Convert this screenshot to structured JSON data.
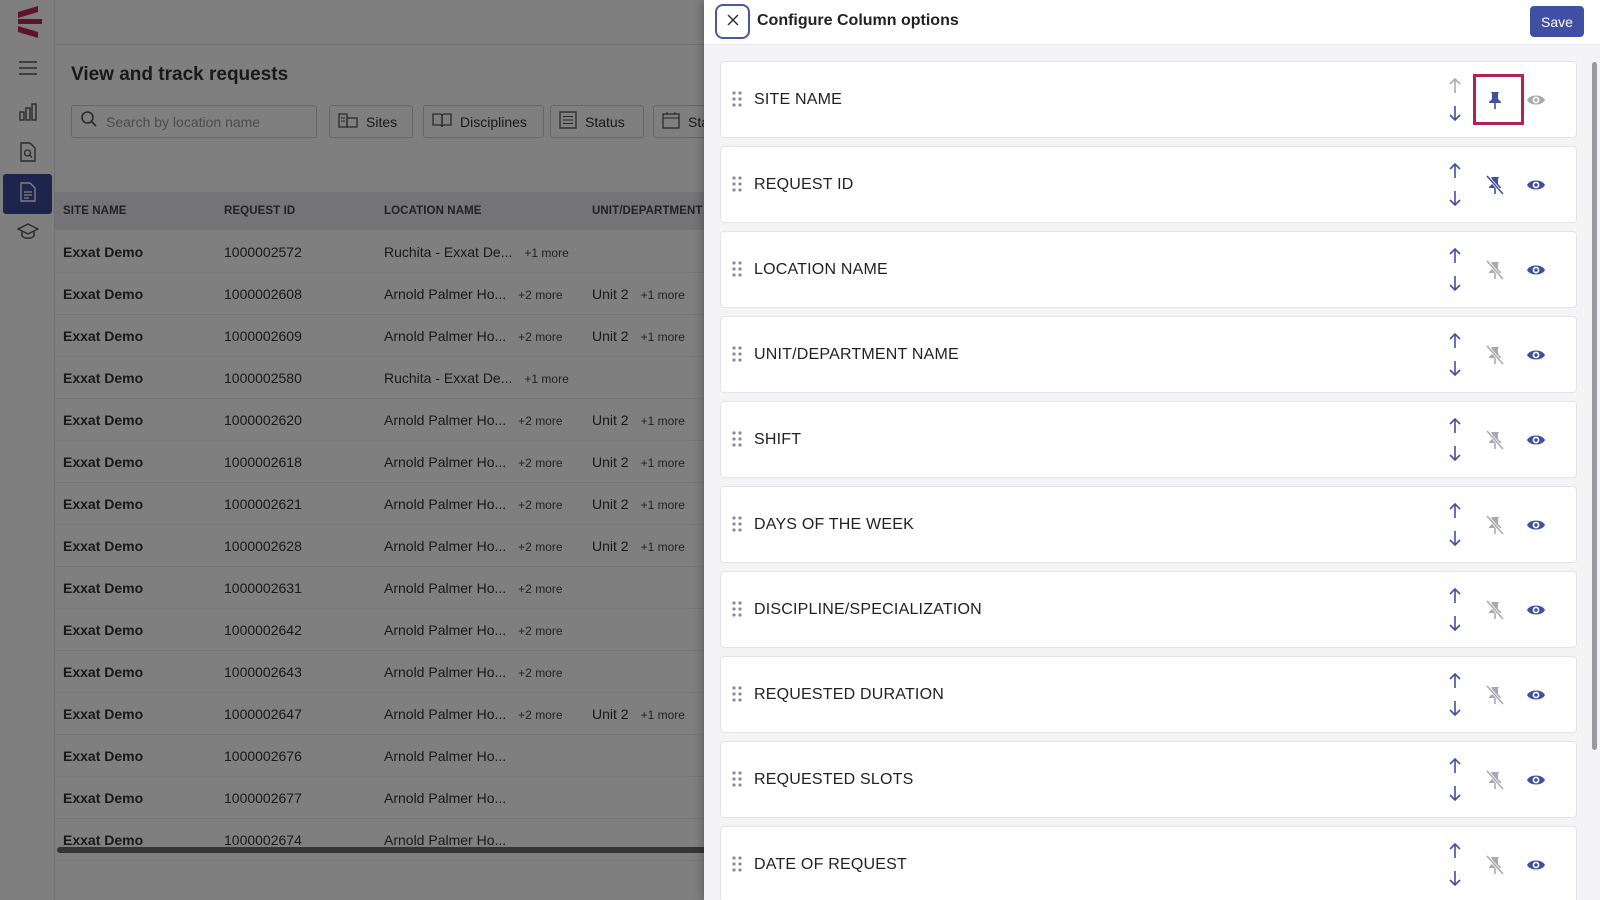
{
  "rail": {
    "items": [
      {
        "icon": "menu-icon",
        "active": false
      },
      {
        "icon": "bar-chart-icon",
        "active": false
      },
      {
        "icon": "document-search-icon",
        "active": false
      },
      {
        "icon": "document-icon",
        "active": true
      },
      {
        "icon": "graduation-cap-icon",
        "active": false
      }
    ]
  },
  "page": {
    "title": "View and track requests",
    "search_placeholder": "Search by location name",
    "filters": [
      {
        "label": "Sites",
        "icon": "sites-icon"
      },
      {
        "label": "Disciplines",
        "icon": "book-icon"
      },
      {
        "label": "Status",
        "icon": "list-icon"
      },
      {
        "label": "Sta",
        "icon": "calendar-icon"
      }
    ],
    "table": {
      "headers": [
        "SITE NAME",
        "REQUEST ID",
        "LOCATION NAME",
        "UNIT/DEPARTMENT N"
      ],
      "rows": [
        {
          "site": "Exxat Demo",
          "id": "1000002572",
          "location": "Ruchita - Exxat De...",
          "loc_more": "+1 more",
          "unit": "",
          "unit_more": ""
        },
        {
          "site": "Exxat Demo",
          "id": "1000002608",
          "location": "Arnold Palmer Ho...",
          "loc_more": "+2 more",
          "unit": "Unit 2",
          "unit_more": "+1 more"
        },
        {
          "site": "Exxat Demo",
          "id": "1000002609",
          "location": "Arnold Palmer Ho...",
          "loc_more": "+2 more",
          "unit": "Unit 2",
          "unit_more": "+1 more"
        },
        {
          "site": "Exxat Demo",
          "id": "1000002580",
          "location": "Ruchita - Exxat De...",
          "loc_more": "+1 more",
          "unit": "",
          "unit_more": ""
        },
        {
          "site": "Exxat Demo",
          "id": "1000002620",
          "location": "Arnold Palmer Ho...",
          "loc_more": "+2 more",
          "unit": "Unit 2",
          "unit_more": "+1 more"
        },
        {
          "site": "Exxat Demo",
          "id": "1000002618",
          "location": "Arnold Palmer Ho...",
          "loc_more": "+2 more",
          "unit": "Unit 2",
          "unit_more": "+1 more"
        },
        {
          "site": "Exxat Demo",
          "id": "1000002621",
          "location": "Arnold Palmer Ho...",
          "loc_more": "+2 more",
          "unit": "Unit 2",
          "unit_more": "+1 more"
        },
        {
          "site": "Exxat Demo",
          "id": "1000002628",
          "location": "Arnold Palmer Ho...",
          "loc_more": "+2 more",
          "unit": "Unit 2",
          "unit_more": "+1 more"
        },
        {
          "site": "Exxat Demo",
          "id": "1000002631",
          "location": "Arnold Palmer Ho...",
          "loc_more": "+2 more",
          "unit": "",
          "unit_more": ""
        },
        {
          "site": "Exxat Demo",
          "id": "1000002642",
          "location": "Arnold Palmer Ho...",
          "loc_more": "+2 more",
          "unit": "",
          "unit_more": ""
        },
        {
          "site": "Exxat Demo",
          "id": "1000002643",
          "location": "Arnold Palmer Ho...",
          "loc_more": "+2 more",
          "unit": "",
          "unit_more": ""
        },
        {
          "site": "Exxat Demo",
          "id": "1000002647",
          "location": "Arnold Palmer Ho...",
          "loc_more": "+2 more",
          "unit": "Unit 2",
          "unit_more": "+1 more"
        },
        {
          "site": "Exxat Demo",
          "id": "1000002676",
          "location": "Arnold Palmer Ho...",
          "loc_more": "",
          "unit": "",
          "unit_more": ""
        },
        {
          "site": "Exxat Demo",
          "id": "1000002677",
          "location": "Arnold Palmer Ho...",
          "loc_more": "",
          "unit": "",
          "unit_more": ""
        },
        {
          "site": "Exxat Demo",
          "id": "1000002674",
          "location": "Arnold Palmer Ho...",
          "loc_more": "",
          "unit": "",
          "unit_more": ""
        }
      ]
    }
  },
  "drawer": {
    "title": "Configure Column options",
    "save_label": "Save",
    "columns": [
      {
        "label": "SITE NAME",
        "pinned": true,
        "visible": true,
        "highlight": true,
        "up_enabled": false
      },
      {
        "label": "REQUEST ID",
        "pinned": false,
        "visible": true,
        "highlight": false,
        "up_enabled": true
      },
      {
        "label": "LOCATION NAME",
        "pinned": false,
        "visible": true,
        "highlight": false,
        "up_enabled": true
      },
      {
        "label": "UNIT/DEPARTMENT NAME",
        "pinned": false,
        "visible": true,
        "highlight": false,
        "up_enabled": true
      },
      {
        "label": "SHIFT",
        "pinned": false,
        "visible": true,
        "highlight": false,
        "up_enabled": true
      },
      {
        "label": "DAYS OF THE WEEK",
        "pinned": false,
        "visible": true,
        "highlight": false,
        "up_enabled": true
      },
      {
        "label": "DISCIPLINE/SPECIALIZATION",
        "pinned": false,
        "visible": true,
        "highlight": false,
        "up_enabled": true
      },
      {
        "label": "REQUESTED DURATION",
        "pinned": false,
        "visible": true,
        "highlight": false,
        "up_enabled": true
      },
      {
        "label": "REQUESTED SLOTS",
        "pinned": false,
        "visible": true,
        "highlight": false,
        "up_enabled": true
      },
      {
        "label": "DATE OF REQUEST",
        "pinned": false,
        "visible": true,
        "highlight": false,
        "up_enabled": true
      }
    ]
  },
  "colors": {
    "accent": "#3f4fa3",
    "highlight": "#b0244f",
    "logo": "#c0245a",
    "icon_muted": "#a9a9b0"
  }
}
